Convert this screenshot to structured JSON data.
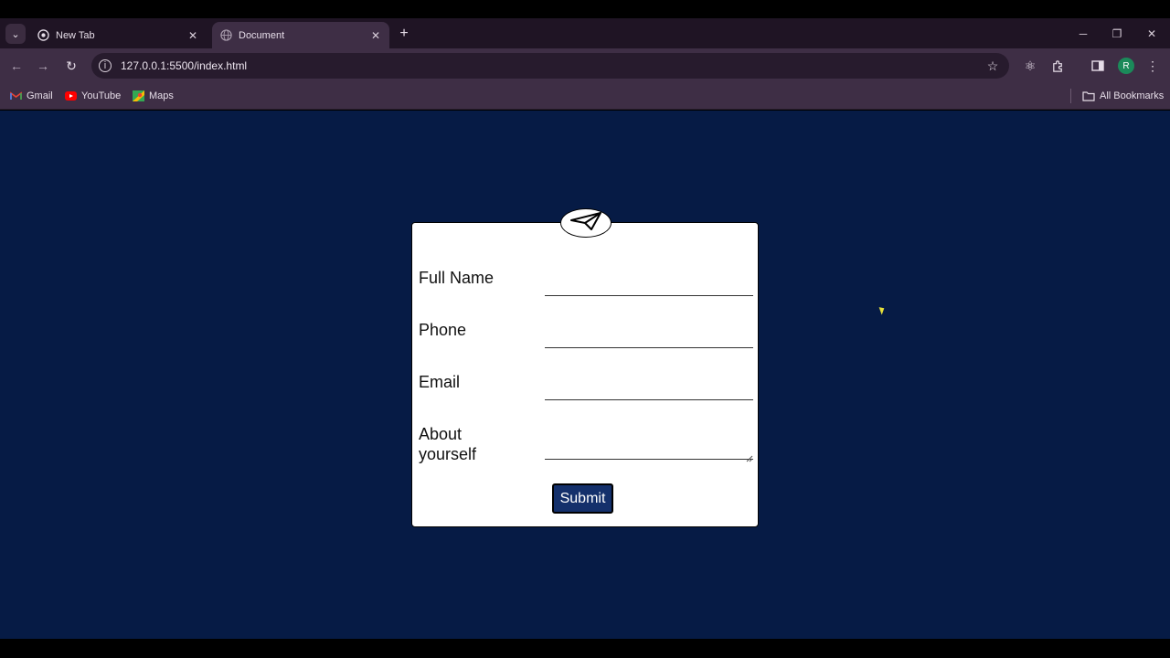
{
  "browser": {
    "tabs": [
      {
        "title": "New Tab",
        "active": false
      },
      {
        "title": "Document",
        "active": true
      }
    ],
    "url": "127.0.0.1:5500/index.html",
    "profile_initial": "R",
    "bookmarks": [
      {
        "label": "Gmail",
        "icon": "gmail-icon"
      },
      {
        "label": "YouTube",
        "icon": "youtube-icon"
      },
      {
        "label": "Maps",
        "icon": "maps-icon"
      }
    ],
    "all_bookmarks_label": "All Bookmarks"
  },
  "form": {
    "fields": [
      {
        "label": "Full Name",
        "type": "text",
        "value": ""
      },
      {
        "label": "Phone",
        "type": "text",
        "value": ""
      },
      {
        "label": "Email",
        "type": "text",
        "value": ""
      },
      {
        "label_line1": "About",
        "label_line2": "yourself",
        "type": "textarea",
        "value": ""
      }
    ],
    "submit_label": "Submit",
    "header_icon": "paper-plane-icon"
  },
  "colors": {
    "page_background": "#061b45",
    "card_background": "#ffffff",
    "submit_background": "#14306b",
    "browser_chrome": "#3e2e45"
  }
}
